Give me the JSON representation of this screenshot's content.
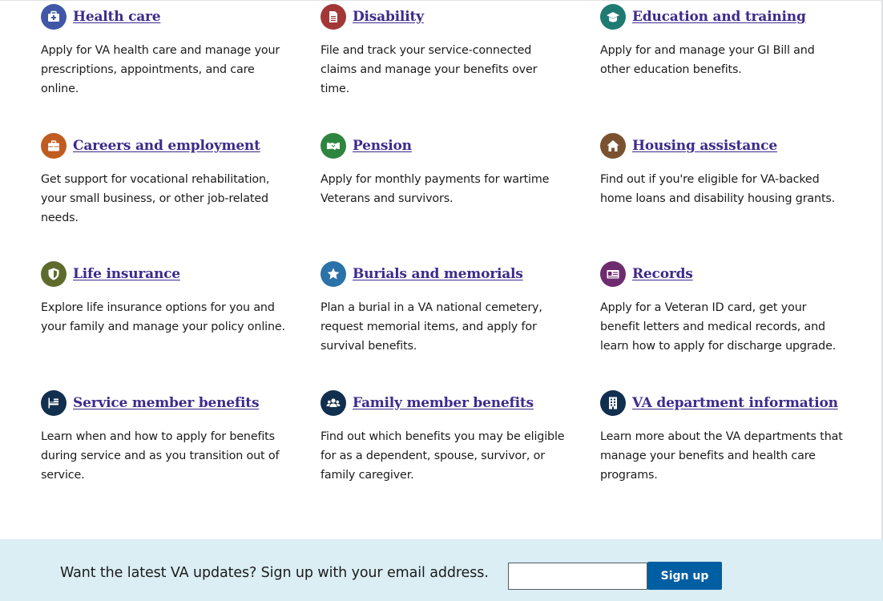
{
  "benefits": [
    {
      "title": "Health care",
      "description": "Apply for VA health care and manage your prescriptions, appointments, and care online.",
      "icon": "medical-kit-icon",
      "color": "#3f57a6"
    },
    {
      "title": "Disability",
      "description": "File and track your service-connected claims and manage your benefits over time.",
      "icon": "document-icon",
      "color": "#a23737"
    },
    {
      "title": "Education and training",
      "description": "Apply for and manage your GI Bill and other education benefits.",
      "icon": "graduation-cap-icon",
      "color": "#1f7a72"
    },
    {
      "title": "Careers and employment",
      "description": "Get support for vocational rehabilitation, your small business, or other job-related needs.",
      "icon": "briefcase-icon",
      "color": "#c05c20"
    },
    {
      "title": "Pension",
      "description": "Apply for monthly payments for wartime Veterans and survivors.",
      "icon": "handshake-icon",
      "color": "#2e8540"
    },
    {
      "title": "Housing assistance",
      "description": "Find out if you're eligible for VA-backed home loans and disability housing grants.",
      "icon": "home-icon",
      "color": "#7a5230"
    },
    {
      "title": "Life insurance",
      "description": "Explore life insurance options for you and your family and manage your policy online.",
      "icon": "shield-icon",
      "color": "#5e6b2d"
    },
    {
      "title": "Burials and memorials",
      "description": "Plan a burial in a VA national cemetery, request memorial items, and apply for survival benefits.",
      "icon": "star-icon",
      "color": "#2a72a8"
    },
    {
      "title": "Records",
      "description": "Apply for a Veteran ID card, get your benefit letters and medical records, and learn how to apply for discharge upgrade.",
      "icon": "id-card-icon",
      "color": "#6e2c6e"
    },
    {
      "title": "Service member benefits",
      "description": "Learn when and how to apply for benefits during service and as you transition out of service.",
      "icon": "flag-icon",
      "color": "#112f4e"
    },
    {
      "title": "Family member benefits",
      "description": "Find out which benefits you may be eligible for as a dependent, spouse, survivor, or family caregiver.",
      "icon": "people-icon",
      "color": "#112f4e"
    },
    {
      "title": "VA department information",
      "description": "Learn more about the VA departments that manage your benefits and health care programs.",
      "icon": "building-icon",
      "color": "#112f4e"
    }
  ],
  "signup": {
    "text": "Want the latest VA updates? Sign up with your email address.",
    "email_value": "",
    "button_label": "Sign up"
  },
  "colors": {
    "link": "#3e2a8c",
    "signup_background": "#daeef4",
    "button": "#005ea2"
  }
}
